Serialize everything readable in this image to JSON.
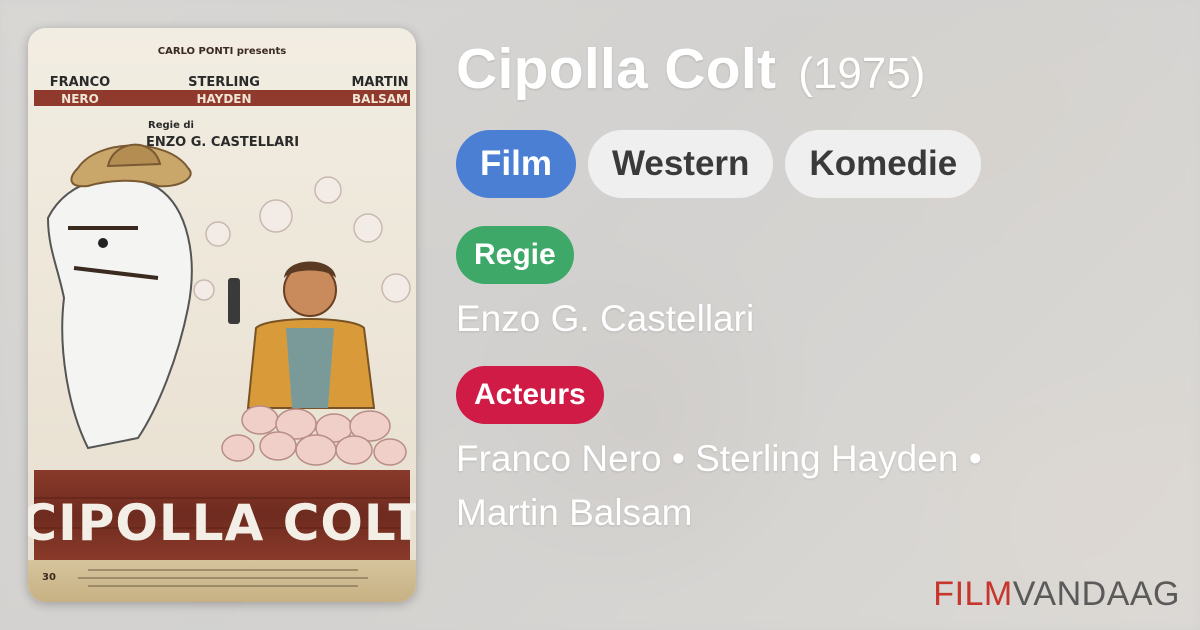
{
  "movie": {
    "title": "Cipolla Colt",
    "year": "(1975)"
  },
  "genres": [
    "Film",
    "Western",
    "Komedie"
  ],
  "director": {
    "label": "Regie",
    "name": "Enzo G. Castellari"
  },
  "actors": {
    "label": "Acteurs",
    "names": [
      "Franco Nero",
      "Sterling Hayden",
      "Martin Balsam"
    ],
    "separator": " • "
  },
  "poster": {
    "producer_line": "CARLO PONTI presents",
    "cast": [
      {
        "first": "FRANCO",
        "last": "NERO"
      },
      {
        "first": "STERLING",
        "last": "HAYDEN"
      },
      {
        "first": "MARTIN",
        "last": "BALSAM"
      }
    ],
    "regie_small": "Regie di",
    "director_caps": "ENZO G. CASTELLARI",
    "big_title": "CIPOLLA COLT",
    "corner_number": "30"
  },
  "brand": {
    "part1": "FILM",
    "part2": "VANDAAG"
  },
  "colors": {
    "film_chip": "#4a7fd4",
    "regie_badge": "#3da868",
    "acteurs_badge": "#cf1b45",
    "brand_red": "#c7352d"
  }
}
